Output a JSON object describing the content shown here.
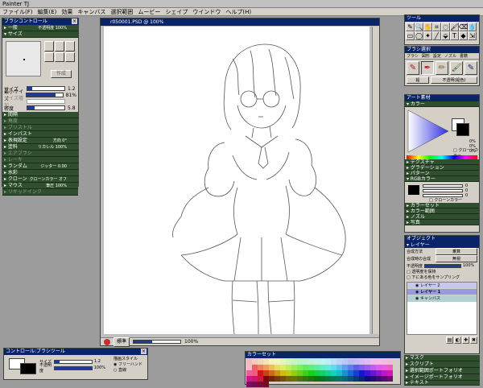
{
  "app": {
    "title": "Painter TJ"
  },
  "menu": [
    "ファイル(F)",
    "編集(E)",
    "効果",
    "キャンバス",
    "選択範囲",
    "ムービー",
    "シェイプ",
    "ウインドウ",
    "ヘルプ(H)"
  ],
  "brush_control": {
    "title": "ブラシコントロール",
    "general": {
      "label": "一般",
      "value": "不透明度 100%"
    },
    "size_section": "サイズ",
    "preview_button": "作成",
    "sliders": [
      {
        "label": "サイズ",
        "value": "1.2",
        "level": 0.12
      },
      {
        "label": "最小サイズ",
        "value": "81%",
        "level": 0.81
      },
      {
        "label": "サイズ増加",
        "value": "",
        "level": 0.0
      },
      {
        "label": "密度",
        "value": "5.8",
        "level": 0.2
      }
    ],
    "groups": [
      {
        "label": "間隔",
        "value": "",
        "dim": false
      },
      {
        "label": "角度",
        "value": "",
        "dim": true
      },
      {
        "label": "ブリストル",
        "value": "",
        "dim": true
      },
      {
        "label": "インパスト",
        "value": "",
        "dim": false
      },
      {
        "label": "表現設定",
        "value": "方向 0°",
        "dim": false
      },
      {
        "label": "塗料",
        "value": "リカレル 100%",
        "dim": false
      },
      {
        "label": "エアブラシ",
        "value": "",
        "dim": true
      },
      {
        "label": "レーキ",
        "value": "",
        "dim": true
      },
      {
        "label": "ランダム",
        "value": "ジッター 0.00",
        "dim": false
      },
      {
        "label": "水彩",
        "value": "",
        "dim": false
      },
      {
        "label": "クローン",
        "value": "クローンカラー オフ",
        "dim": false
      },
      {
        "label": "マウス",
        "value": "筆圧 100%",
        "dim": false
      },
      {
        "label": "リキッドインク",
        "value": "",
        "dim": true
      }
    ]
  },
  "document": {
    "title": "r050001.PSD @ 100%",
    "status_label": "標準",
    "zoom": "100%"
  },
  "toolbox": {
    "title": "ツール",
    "tools": [
      "pen",
      "magnifier",
      "hand",
      "crop",
      "lasso",
      "brush",
      "eraser",
      "dropper",
      "rect-select",
      "oval-select",
      "magic-wand",
      "line",
      "bucket",
      "text",
      "shape",
      "transform"
    ]
  },
  "brush_selector": {
    "title": "ブラシ選択",
    "tabs": [
      "ブラシ",
      "図形",
      "設定",
      "ノズル",
      "書籍"
    ],
    "category": "鉛",
    "variant": "不透明(鉛色)"
  },
  "art_materials": {
    "title": "アート素材",
    "sections": {
      "color": "カラー",
      "texture": "テクスチャ",
      "gradient": "グラデーション",
      "pattern": "パターン",
      "rgb": "RGBカラー",
      "colorset": "カラーセット",
      "colorrange": "カラー範囲",
      "nozzle": "ノズル",
      "image": "写真"
    },
    "hsv": {
      "h": "0%",
      "s": "0%",
      "v": "0%"
    },
    "rgb": {
      "r": "0",
      "g": "0",
      "b": "0"
    },
    "clone_color": "クローンカラー",
    "accent": "#0a246a"
  },
  "objects": {
    "title": "オブジェクト",
    "tab": "レイヤー",
    "composite_method_label": "合成方法",
    "composite_method": "乗算",
    "depth_label": "合成時の合成",
    "depth": "無視",
    "opacity_label": "不透明度",
    "opacity": "100%",
    "opacity_level": 1.0,
    "checks": [
      "透明度を保持",
      "下にある色をサンプリング"
    ],
    "layers": [
      "レイヤー 2",
      "レイヤー 1",
      "キャンバス"
    ]
  },
  "lower_panels": [
    "マスク",
    "スクリプト",
    "選択範囲ポートフォリオ",
    "イメージポートフォリオ",
    "テキスト"
  ],
  "control_panel": {
    "title": "コントロール:ブラシツール",
    "size_label": "サイズ",
    "size_value": "1.2",
    "opacity_label": "不透明度",
    "opacity_value": "100%",
    "style_label": "描画スタイル",
    "options": [
      "フリーハンド",
      "直線"
    ]
  },
  "colorset": {
    "title": "カラーセット"
  }
}
